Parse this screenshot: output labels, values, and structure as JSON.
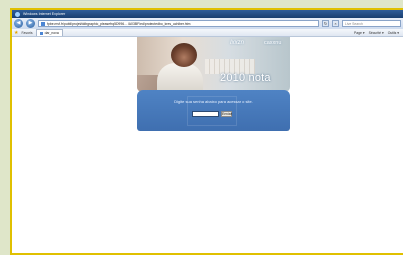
{
  "browser": {
    "title": "Windows Internet Explorer",
    "address": "fpbe.mvf.fr/publi/projet/ddbgraphic_pleasefrq5D996... /A03BF/ed/protectedbo_kres_uchiber.htm",
    "search_placeholder": "Live Search",
    "favorites_label": "Favoris",
    "tab_title": "dar_nova",
    "toolbar_items": [
      "Page ▾",
      "Sécurité ▾",
      "Outils ▾"
    ],
    "back_icon": "back-arrow",
    "forward_icon": "forward-arrow"
  },
  "page": {
    "logo_left": "Ixxzn",
    "logo_right": "caxxnu",
    "headline": "2010 nota",
    "prompt": "Digite sua senha abaixo para acessar o site.",
    "password_value": "",
    "ok_label": "Enviar",
    "colors": {
      "panel_blue": "#4a7fc0",
      "window_border": "#e0c000"
    }
  }
}
